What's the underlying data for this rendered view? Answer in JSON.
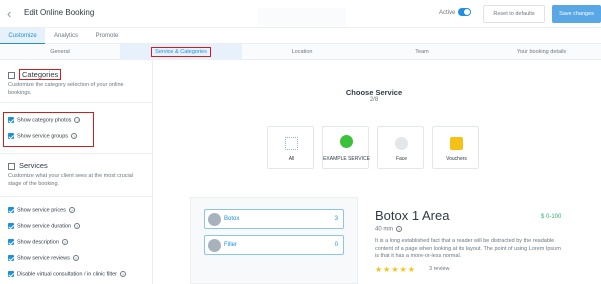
{
  "header": {
    "title": "Edit Online Booking",
    "active_label": "Active",
    "reset_label": "Reset to defaults",
    "save_label": "Save changes"
  },
  "main_tabs": [
    {
      "label": "Customize",
      "active": true
    },
    {
      "label": "Analytics",
      "active": false
    },
    {
      "label": "Promote",
      "active": false
    }
  ],
  "sub_tabs": [
    {
      "label": "General",
      "active": false
    },
    {
      "label": "Service & Categories",
      "active": true
    },
    {
      "label": "Location",
      "active": false
    },
    {
      "label": "Team",
      "active": false
    },
    {
      "label": "Your booking details",
      "active": false
    }
  ],
  "sidebar": {
    "categories": {
      "title": "Categories",
      "description": "Customize the category selection of your online bookings.",
      "options": [
        {
          "label": "Show category photos",
          "checked": true,
          "info": true
        },
        {
          "label": "Show service groups",
          "checked": true,
          "info": true
        }
      ]
    },
    "services": {
      "title": "Services",
      "description": "Customize what your client sees at the most crucial stage of the booking.",
      "options": [
        {
          "label": "Show service prices",
          "checked": true,
          "info": true
        },
        {
          "label": "Show service duration",
          "checked": true,
          "info": true
        },
        {
          "label": "Show description",
          "checked": true,
          "info": true
        },
        {
          "label": "Show service reviews",
          "checked": true,
          "info": true
        },
        {
          "label": "Disable virtual consultation / in clinic filter",
          "checked": true,
          "info": true
        }
      ]
    }
  },
  "preview": {
    "title": "Choose Service",
    "step": "2/8",
    "categories": [
      {
        "label": "All",
        "icon": "grid-icon",
        "color": "#8ab4e0"
      },
      {
        "label": "EXAMPLE SERVICE",
        "icon": "leaf-icon",
        "color": "#3cc13b"
      },
      {
        "label": "Face",
        "icon": "face-icon",
        "color": "#e4e7ea"
      },
      {
        "label": "Vouchers",
        "icon": "voucher-icon",
        "color": "#f5c116"
      }
    ],
    "services": [
      {
        "name": "Botox",
        "count": "3"
      },
      {
        "name": "Filler",
        "count": "0"
      }
    ],
    "detail": {
      "title": "Botox 1 Area",
      "price": "$ 0-100",
      "duration": "40 min",
      "description": "It is a long established fact that a reader will be distracted by the readable content of a page when looking at its layout. The point of using Lorem Ipsum is that it has a more-or-less normal.",
      "stars": "★★★★★",
      "rating_value": 5,
      "reviews": "3 review"
    }
  },
  "colors": {
    "accent": "#1f8fe0",
    "highlight": "#cc2020",
    "price": "#2bb36f",
    "star": "#f5c116"
  }
}
